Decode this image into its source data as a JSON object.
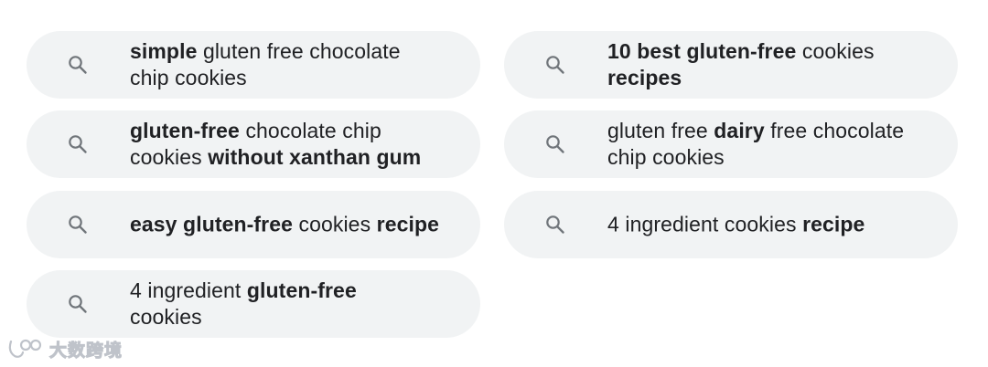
{
  "suggestions": [
    {
      "id": "s1",
      "segments": [
        {
          "text": "simple",
          "bold": true
        },
        {
          "text": " gluten free chocolate ",
          "bold": false
        },
        {
          "text": "chip cookies",
          "bold": false
        }
      ]
    },
    {
      "id": "s2",
      "segments": [
        {
          "text": "10 best gluten-free",
          "bold": true
        },
        {
          "text": " cookies ",
          "bold": false
        },
        {
          "text": "recipes",
          "bold": true
        }
      ]
    },
    {
      "id": "s3",
      "segments": [
        {
          "text": "gluten-free",
          "bold": true
        },
        {
          "text": " chocolate chip cookies ",
          "bold": false
        },
        {
          "text": "without xanthan gum",
          "bold": true
        }
      ]
    },
    {
      "id": "s4",
      "segments": [
        {
          "text": "gluten free ",
          "bold": false
        },
        {
          "text": "dairy",
          "bold": true
        },
        {
          "text": " free chocolate chip cookies",
          "bold": false
        }
      ]
    },
    {
      "id": "s5",
      "segments": [
        {
          "text": "easy gluten-free",
          "bold": true
        },
        {
          "text": " cookies ",
          "bold": false
        },
        {
          "text": "recipe",
          "bold": true
        }
      ]
    },
    {
      "id": "s6",
      "segments": [
        {
          "text": "4 ingredient cookies ",
          "bold": false
        },
        {
          "text": "recipe",
          "bold": true
        }
      ]
    },
    {
      "id": "s7",
      "segments": [
        {
          "text": "4 ingredient ",
          "bold": false
        },
        {
          "text": "gluten-free",
          "bold": true
        },
        {
          "text": " cookies",
          "bold": false
        }
      ]
    }
  ],
  "icon": "search-icon",
  "colors": {
    "chip_background": "#f1f3f4",
    "text": "#202124",
    "icon": "#70757a"
  },
  "watermark": {
    "text": "大数跨境"
  }
}
